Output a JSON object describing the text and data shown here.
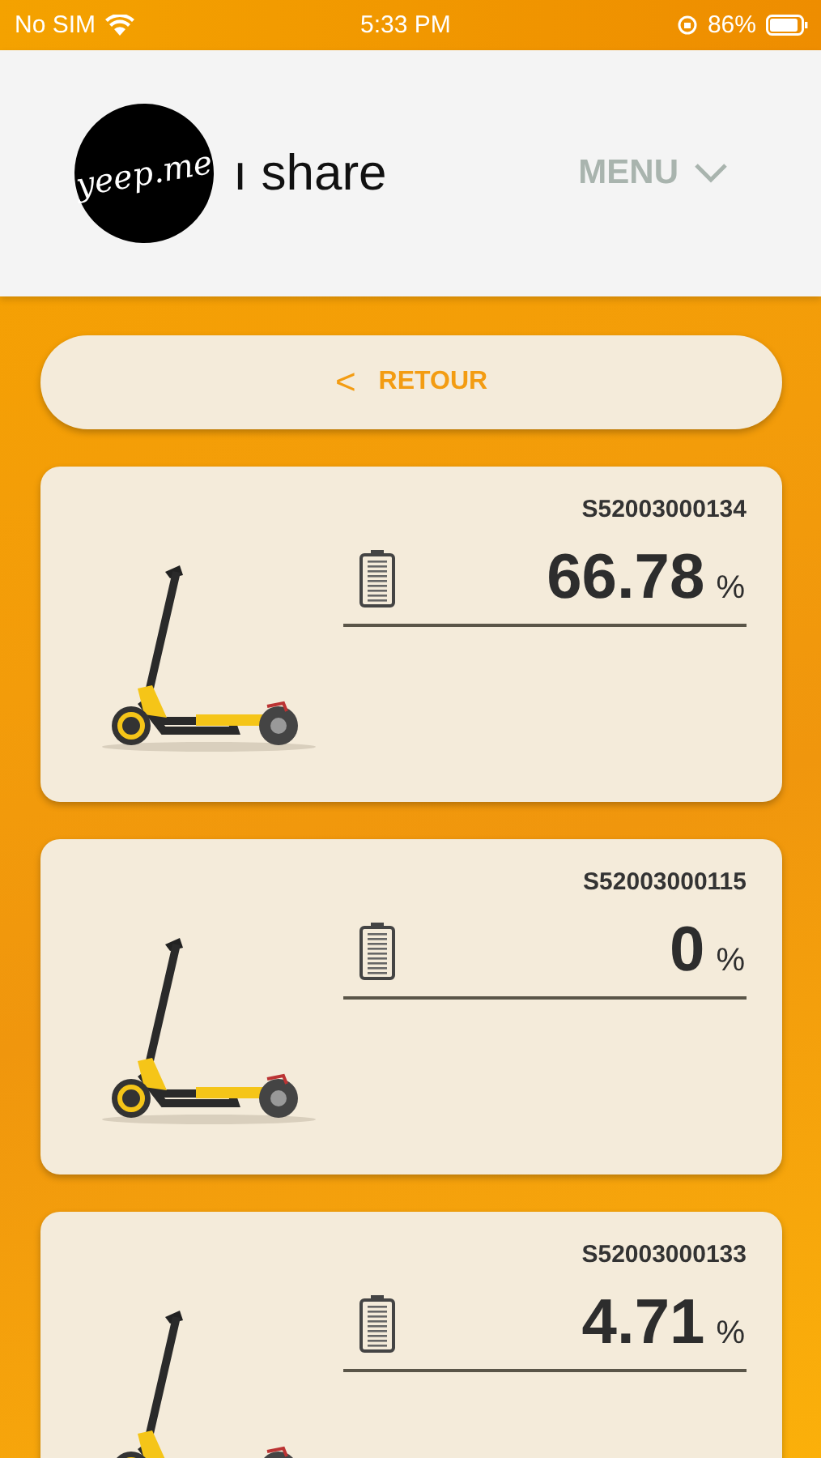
{
  "status_bar": {
    "carrier": "No SIM",
    "time": "5:33 PM",
    "battery": "86%"
  },
  "header": {
    "logo": "yeep.me",
    "title": "ı share",
    "menu": "MENU"
  },
  "back_button": {
    "icon": "<",
    "label": "RETOUR"
  },
  "scooters": [
    {
      "id": "S52003000134",
      "charge": "66.78",
      "unit": "%"
    },
    {
      "id": "S52003000115",
      "charge": "0",
      "unit": "%"
    },
    {
      "id": "S52003000133",
      "charge": "4.71",
      "unit": "%"
    }
  ]
}
